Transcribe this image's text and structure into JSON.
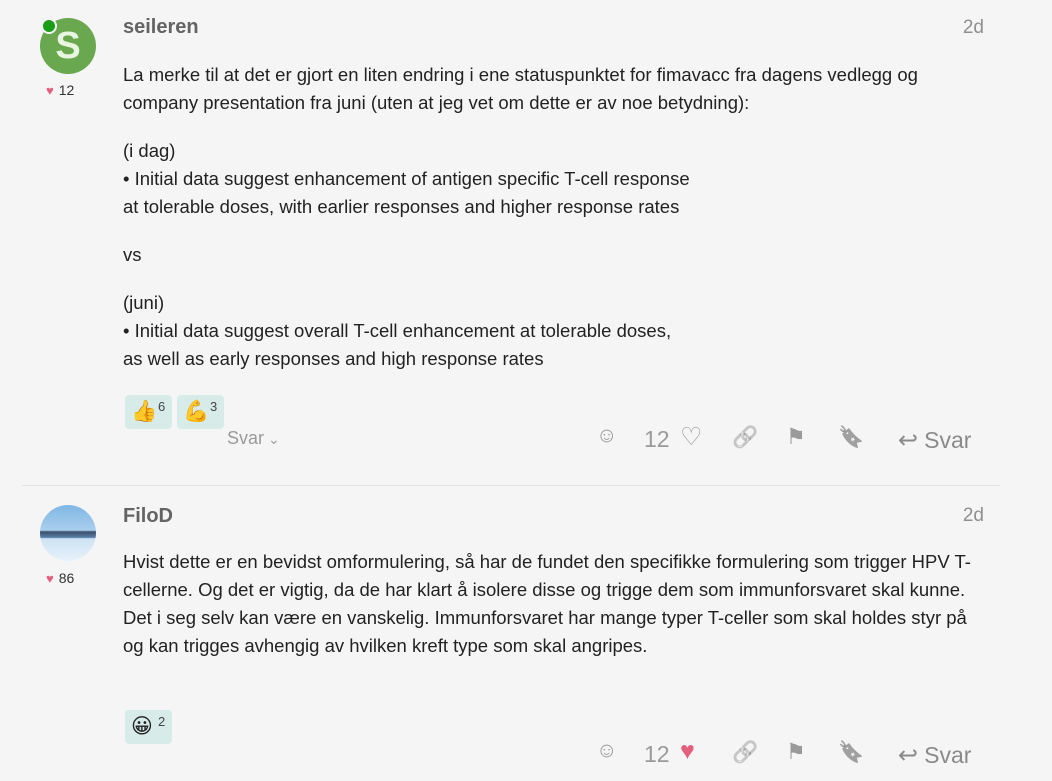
{
  "post1": {
    "username": "seileren",
    "avatar_letter": "S",
    "user_likes": "12",
    "date": "2d",
    "intro": "La merke til at det er gjort en liten endring i ene statuspunktet for fimavacc fra dagens vedlegg og company presentation fra juni (uten at jeg vet om dette er av noe betydning):",
    "today_label": "(i dag)",
    "today_line1": "• Initial data suggest enhancement of antigen specific T-cell response",
    "today_line2": "at tolerable doses, with earlier responses and higher response rates",
    "vs": "vs",
    "june_label": "(juni)",
    "june_line1": "• Initial data suggest overall T-cell enhancement at tolerable doses,",
    "june_line2": "as well as early responses and high response rates",
    "reactions": [
      {
        "emoji": "👍",
        "count": "6"
      },
      {
        "emoji": "💪",
        "count": "3"
      }
    ],
    "replies_toggle": "Svar",
    "like_count": "12",
    "reply_label": "Svar"
  },
  "post2": {
    "username": "FiloD",
    "user_likes": "86",
    "date": "2d",
    "line1": "Hvist dette er en bevidst omformulering, så har de fundet den specifikke formulering som trigger HPV T-cellerne. Og det er vigtig, da de har klart å isolere disse og trigge dem som immunforsvaret skal kunne.",
    "line2": "Det i seg selv kan være en vanskelig. Immunforsvaret har mange typer T-celler som skal holdes styr på og kan trigges avhengig av hvilken kreft type som skal angripes.",
    "reactions": [
      {
        "emoji": "😀",
        "count": "2"
      }
    ],
    "like_count": "12",
    "reply_label": "Svar"
  },
  "icons": {
    "heart_small": "♥",
    "heart_outline": "♡",
    "heart_filled": "♥",
    "smile": "☺",
    "link": "🔗",
    "flag": "⚑",
    "bookmark": "🔖",
    "reply": "↩",
    "chevron": "⌄"
  },
  "colors": {
    "background": "#f5f5f5",
    "reaction_bg": "#d7ece9",
    "heart": "#e45f7e",
    "online": "#1a9e1a",
    "avatar_green": "#6aa84f"
  }
}
